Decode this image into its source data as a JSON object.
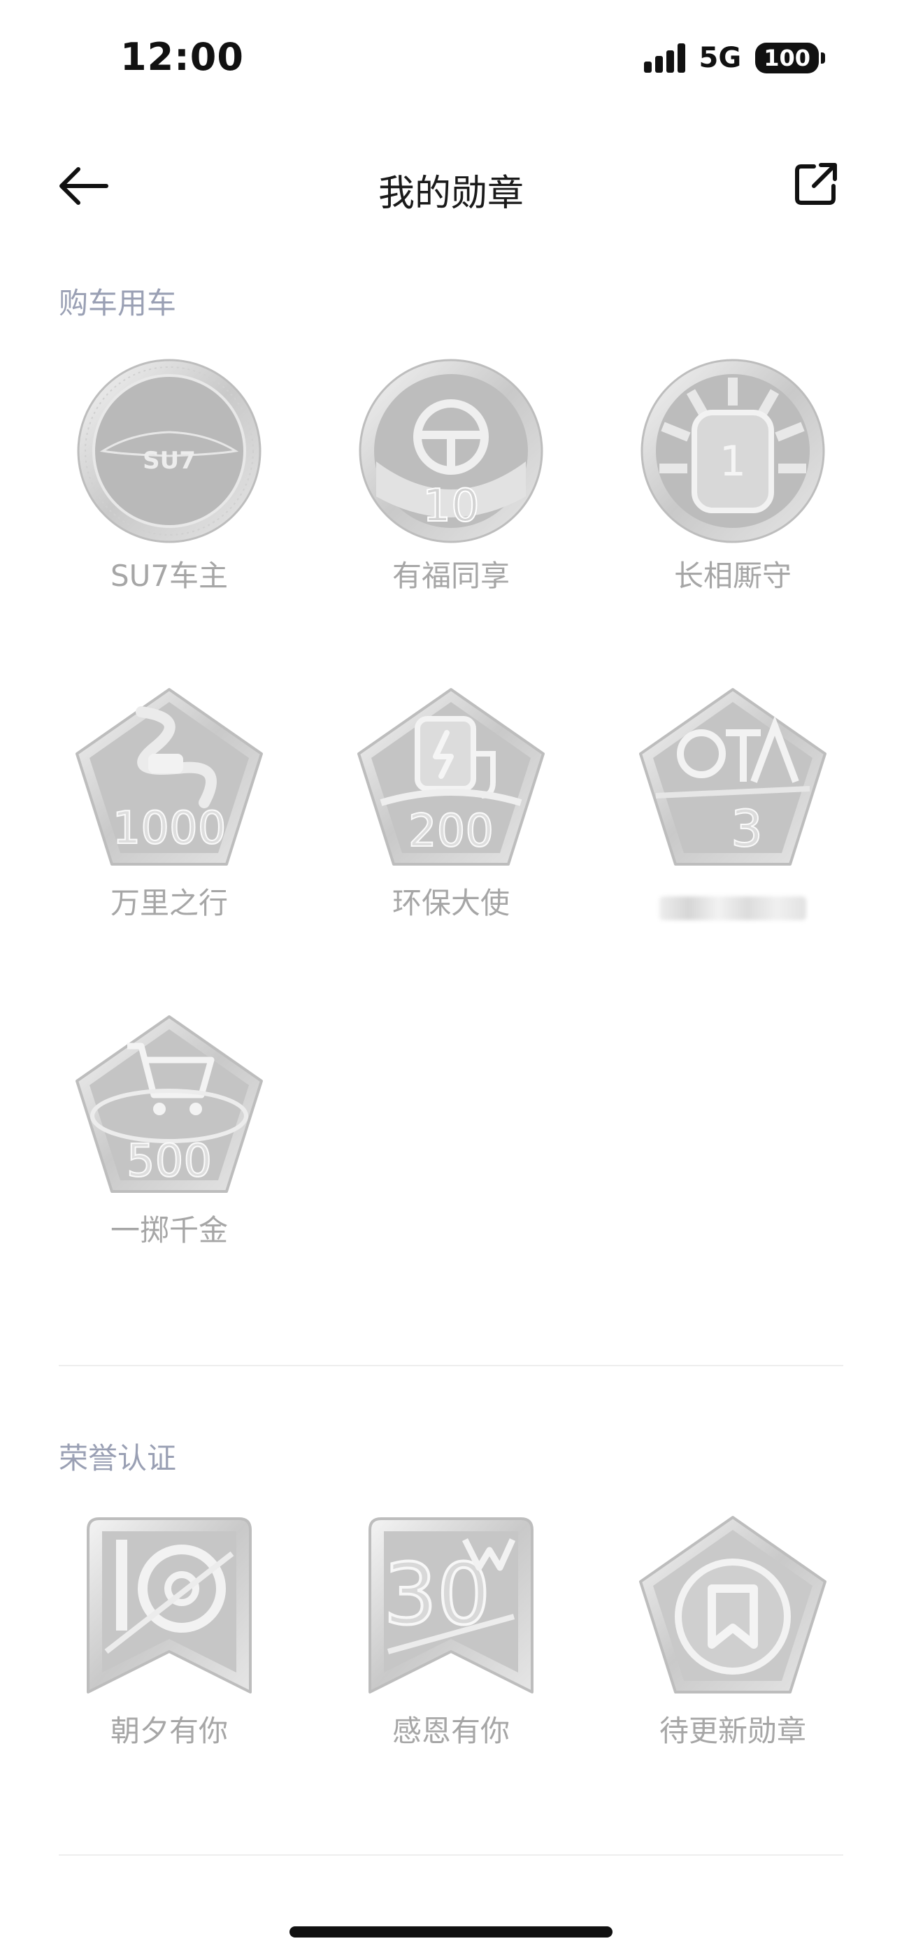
{
  "status_bar": {
    "time": "12:00",
    "network": "5G",
    "battery": "100"
  },
  "header": {
    "title": "我的勋章"
  },
  "sections": [
    {
      "title": "购车用车",
      "badges": [
        {
          "label": "SU7车主",
          "emblem": "SU7"
        },
        {
          "label": "有福同享",
          "emblem": "10"
        },
        {
          "label": "长相厮守",
          "emblem": "1"
        },
        {
          "label": "万里之行",
          "emblem": "1000"
        },
        {
          "label": "环保大使",
          "emblem": "200"
        },
        {
          "label": "",
          "emblem": "3"
        },
        {
          "label": "一掷千金",
          "emblem": "500"
        }
      ]
    },
    {
      "title": "荣誉认证",
      "badges": [
        {
          "label": "朝夕有你",
          "emblem": "10"
        },
        {
          "label": "感恩有你",
          "emblem": "30"
        },
        {
          "label": "待更新勋章",
          "emblem": ""
        }
      ]
    }
  ],
  "icons": {
    "back": "arrow-left-icon",
    "share": "share-icon"
  },
  "colors": {
    "section_title": "#9aa0b4",
    "badge_label": "#a6a6a6",
    "badge_silver": "#c8c8c8"
  }
}
